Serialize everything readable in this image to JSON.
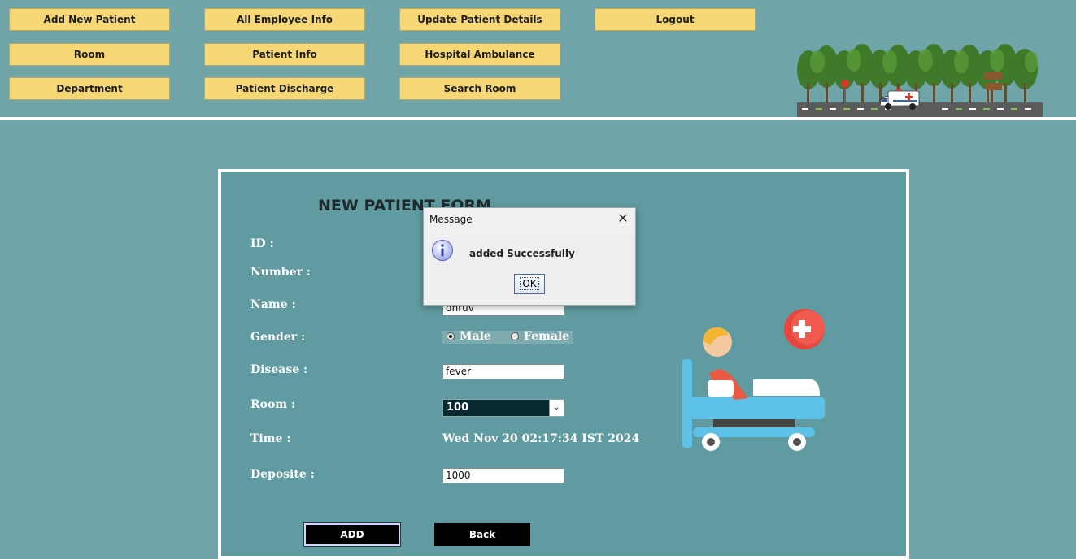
{
  "nav": {
    "add_new_patient": "Add New Patient",
    "all_employee_info": "All Employee Info",
    "update_patient_details": "Update Patient Details",
    "logout": "Logout",
    "room": "Room",
    "patient_info": "Patient Info",
    "hospital_ambulance": "Hospital Ambulance",
    "department": "Department",
    "patient_discharge": "Patient Discharge",
    "search_room": "Search Room"
  },
  "form": {
    "title": "NEW PATIENT FORM",
    "labels": {
      "id": "ID :",
      "number": "Number :",
      "name": "Name :",
      "gender": "Gender :",
      "disease": "Disease :",
      "room": "Room :",
      "time": "Time :",
      "deposite": "Deposite :"
    },
    "values": {
      "name": "dhruv",
      "gender_male": "Male",
      "gender_female": "Female",
      "gender_selected": "Male",
      "disease": "fever",
      "room": "100",
      "time": "Wed Nov 20 02:17:34 IST 2024",
      "deposite": "1000"
    },
    "buttons": {
      "add": "ADD",
      "back": "Back"
    }
  },
  "dialog": {
    "title": "Message",
    "message": "added Successfully",
    "ok": "OK",
    "icon": "info-icon"
  },
  "colors": {
    "background": "#6fa4a8",
    "panel": "#5f9ba1",
    "nav_button": "#f5d776",
    "action_button": "#000000"
  }
}
